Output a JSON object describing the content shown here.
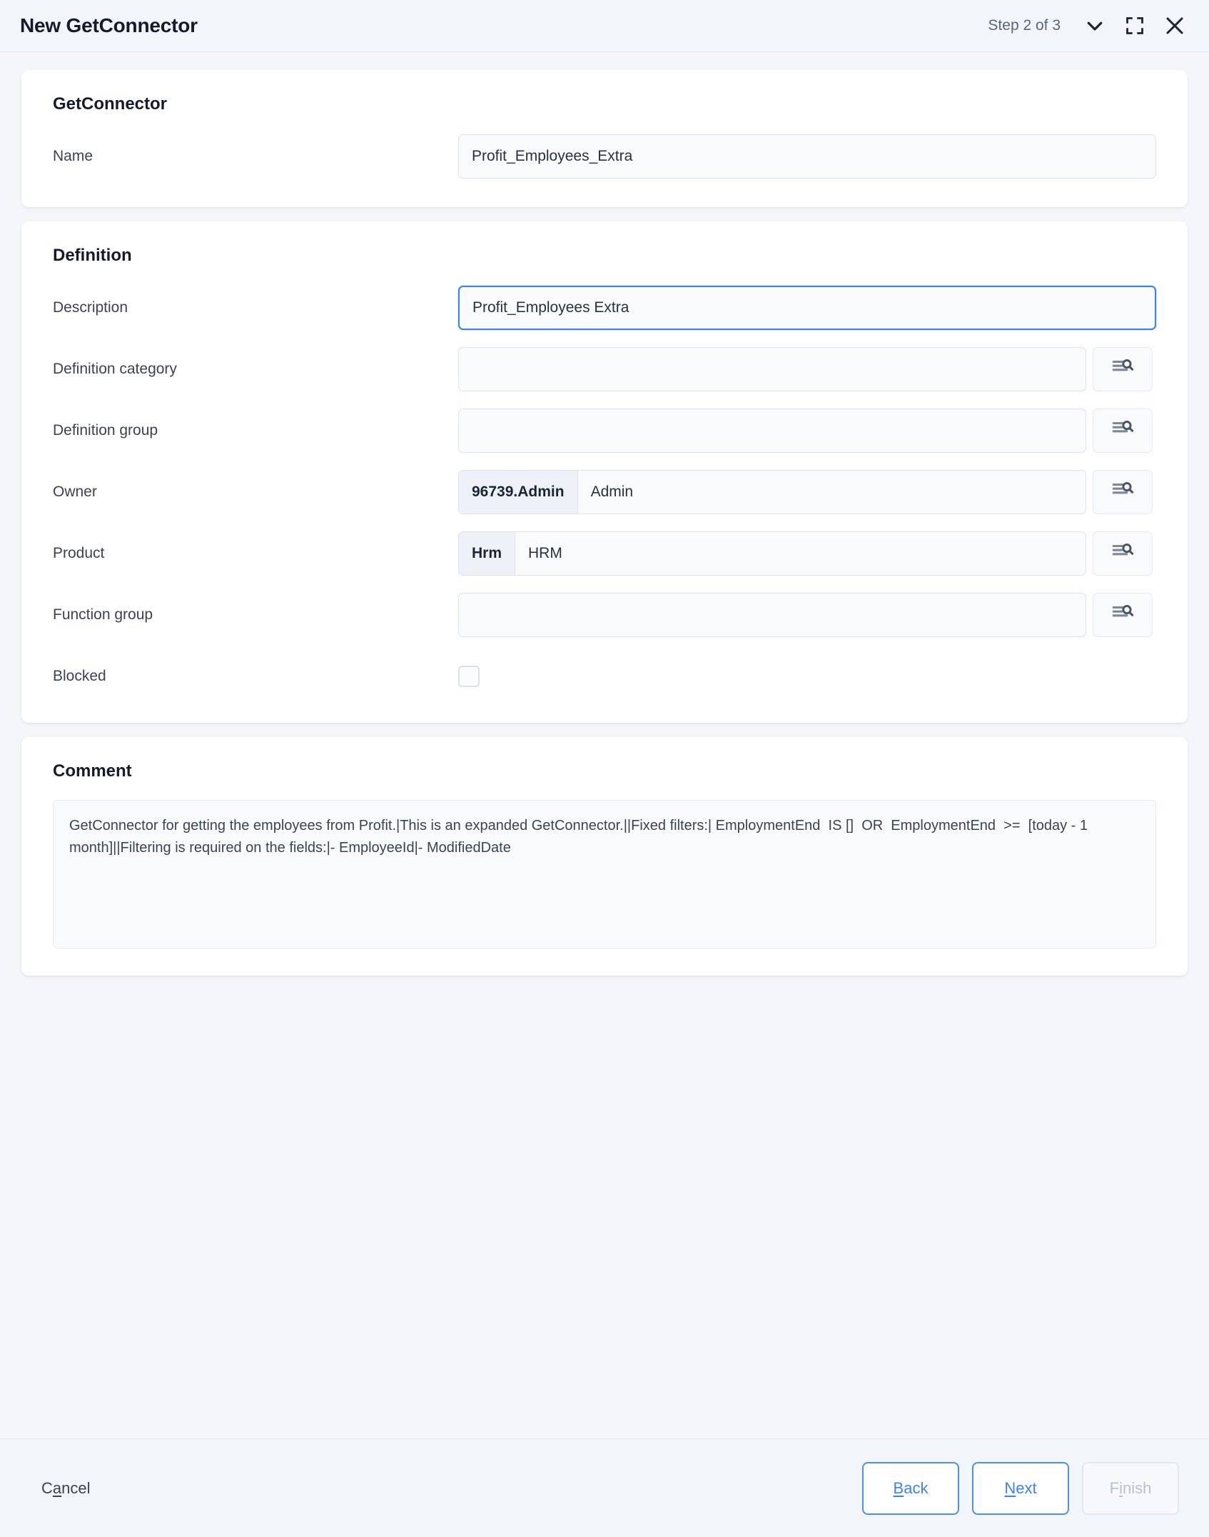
{
  "header": {
    "title": "New GetConnector",
    "step": "Step 2 of 3",
    "collapse_icon": "chevron-down-icon",
    "maximize_icon": "maximize-icon",
    "close_icon": "close-icon"
  },
  "connector_section": {
    "title": "GetConnector",
    "name_label": "Name",
    "name_value": "Profit_Employees_Extra"
  },
  "definition_section": {
    "title": "Definition",
    "rows": [
      {
        "label": "Description",
        "value": "Profit_Employees Extra",
        "type": "text",
        "focused": true,
        "lookup": false
      },
      {
        "label": "Definition category",
        "value": "",
        "type": "text",
        "focused": false,
        "lookup": true
      },
      {
        "label": "Definition group",
        "value": "",
        "type": "text",
        "focused": false,
        "lookup": true
      },
      {
        "label": "Owner",
        "code": "96739.Admin",
        "value": "Admin",
        "type": "compound",
        "focused": false,
        "lookup": true
      },
      {
        "label": "Product",
        "code": "Hrm",
        "value": "HRM",
        "type": "compound",
        "focused": false,
        "lookup": true
      },
      {
        "label": "Function group",
        "value": "",
        "type": "text",
        "focused": false,
        "lookup": true
      },
      {
        "label": "Blocked",
        "value": "",
        "type": "checkbox",
        "checked": false,
        "lookup": false
      }
    ],
    "lookup_icon": "lookup-list-search-icon"
  },
  "comment_section": {
    "title": "Comment",
    "text": "GetConnector for getting the employees from Profit.|This is an expanded GetConnector.||Fixed filters:| EmploymentEnd  IS []  OR  EmploymentEnd  >=  [today - 1 month]||Filtering is required on the fields:|- EmployeeId|- ModifiedDate"
  },
  "footer": {
    "cancel": {
      "pre": "C",
      "key": "a",
      "post": "ncel"
    },
    "back": {
      "pre": "",
      "key": "B",
      "post": "ack"
    },
    "next": {
      "pre": "",
      "key": "N",
      "post": "ext"
    },
    "finish": {
      "pre": "F",
      "key": "i",
      "post": "nish"
    }
  },
  "colors": {
    "accent": "#3b82f6",
    "page_bg": "#f4f6fa",
    "card_bg": "#ffffff",
    "field_bg": "#f8fafc",
    "text": "#151b2d"
  }
}
